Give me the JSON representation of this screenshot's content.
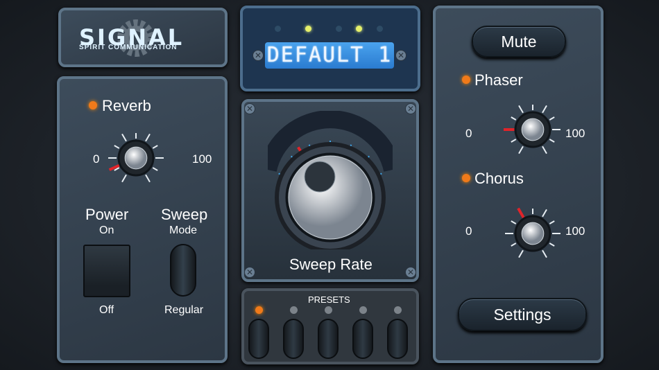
{
  "logo": {
    "title": "SIGNAL",
    "subtitle": "SPIRIT COMMUNICATION"
  },
  "display": {
    "text": "DEFAULT 1",
    "indicators": [
      false,
      true,
      false,
      true,
      false
    ]
  },
  "reverb": {
    "label": "Reverb",
    "min": "0",
    "max": "100",
    "value": 12
  },
  "power": {
    "label": "Power",
    "on_label": "On",
    "off_label": "Off",
    "state": "off"
  },
  "sweep_mode": {
    "label": "Sweep",
    "sub_label": "Mode",
    "value": "Regular"
  },
  "sweep_rate": {
    "label": "Sweep Rate",
    "value": 25
  },
  "presets": {
    "label": "PRESETS",
    "active": 0,
    "count": 5
  },
  "mute": {
    "label": "Mute"
  },
  "phaser": {
    "label": "Phaser",
    "min": "0",
    "max": "100",
    "value": 20
  },
  "chorus": {
    "label": "Chorus",
    "min": "0",
    "max": "100",
    "value": 40
  },
  "settings": {
    "label": "Settings"
  },
  "colors": {
    "accent": "#f07a1a",
    "lcd": "#3a93e4",
    "indicator": "#e6f06a"
  }
}
